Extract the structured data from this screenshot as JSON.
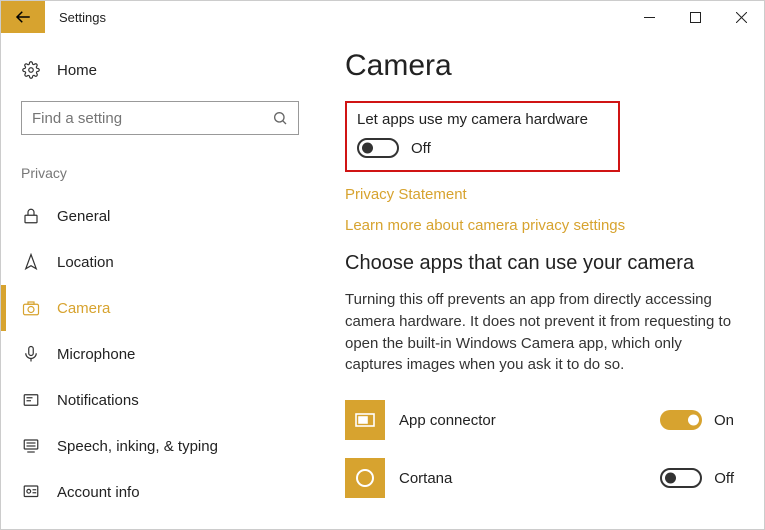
{
  "window": {
    "title": "Settings"
  },
  "sidebar": {
    "home": "Home",
    "search_placeholder": "Find a setting",
    "section": "Privacy",
    "items": [
      {
        "label": "General"
      },
      {
        "label": "Location"
      },
      {
        "label": "Camera"
      },
      {
        "label": "Microphone"
      },
      {
        "label": "Notifications"
      },
      {
        "label": "Speech, inking, & typing"
      },
      {
        "label": "Account info"
      }
    ]
  },
  "main": {
    "title": "Camera",
    "master_toggle": {
      "label": "Let apps use my camera hardware",
      "state": "Off"
    },
    "links": {
      "privacy": "Privacy Statement",
      "learn": "Learn more about camera privacy settings"
    },
    "choose_heading": "Choose apps that can use your camera",
    "description": "Turning this off prevents an app from directly accessing camera hardware. It does not prevent it from requesting to open the built-in Windows Camera app, which only captures images when you ask it to do so.",
    "apps": [
      {
        "name": "App connector",
        "state": "On"
      },
      {
        "name": "Cortana",
        "state": "Off"
      }
    ]
  }
}
